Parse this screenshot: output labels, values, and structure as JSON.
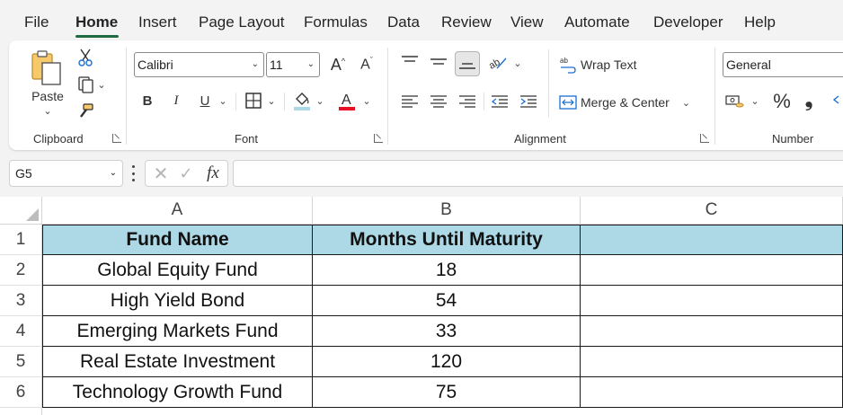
{
  "tabs": [
    "File",
    "Home",
    "Insert",
    "Page Layout",
    "Formulas",
    "Data",
    "Review",
    "View",
    "Automate",
    "Developer",
    "Help"
  ],
  "active_tab": "Home",
  "ribbon": {
    "clipboard": {
      "paste_label": "Paste",
      "group_label": "Clipboard"
    },
    "font": {
      "font_name": "Calibri",
      "font_size": "11",
      "bold": "B",
      "italic": "I",
      "underline": "U",
      "group_label": "Font"
    },
    "alignment": {
      "wrap_text": "Wrap Text",
      "merge_center": "Merge & Center",
      "group_label": "Alignment"
    },
    "number": {
      "format": "General",
      "percent": "%",
      "comma": "❟",
      "group_label": "Number"
    }
  },
  "formula_bar": {
    "name_box": "G5",
    "fx_label": "fx",
    "formula": ""
  },
  "columns": [
    "A",
    "B",
    "C"
  ],
  "rows": [
    "1",
    "2",
    "3",
    "4",
    "5",
    "6"
  ],
  "table": {
    "headers": [
      "Fund Name",
      "Months Until Maturity"
    ],
    "rows": [
      [
        "Global Equity Fund",
        "18"
      ],
      [
        "High Yield Bond",
        "54"
      ],
      [
        "Emerging Markets Fund",
        "33"
      ],
      [
        "Real Estate Investment",
        "120"
      ],
      [
        "Technology Growth Fund",
        "75"
      ]
    ]
  },
  "colors": {
    "accent": "#1e6b41",
    "header_fill": "#add8e6",
    "font_color_bar": "#e81123",
    "highlight_bar": "#add8e6"
  }
}
